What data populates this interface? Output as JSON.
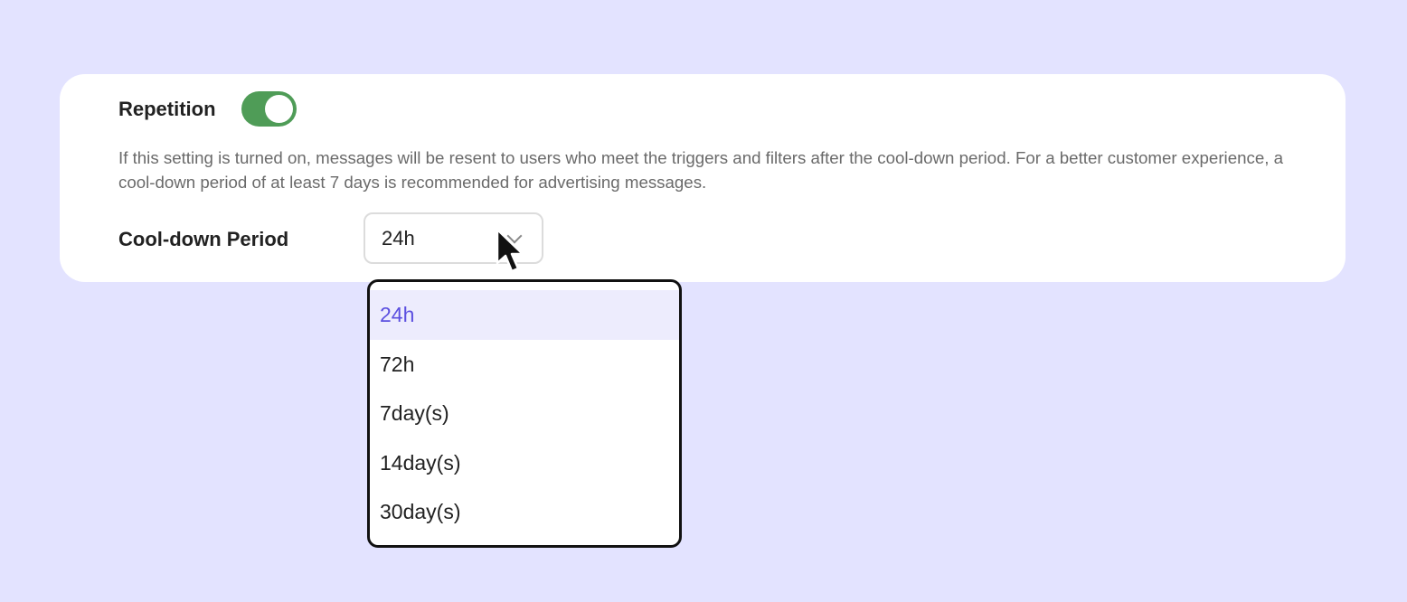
{
  "setting": {
    "title": "Repetition",
    "enabled": true,
    "description": "If this setting is turned on, messages will be resent to users who meet the triggers and filters after the cool-down period. For a better customer experience, a cool-down period of at least 7 days is recommended for advertising messages."
  },
  "cooldown": {
    "label": "Cool-down Period",
    "selected": "24h",
    "options": [
      {
        "label": "24h",
        "selected": true
      },
      {
        "label": "72h",
        "selected": false
      },
      {
        "label": "7day(s)",
        "selected": false
      },
      {
        "label": "14day(s)",
        "selected": false
      },
      {
        "label": "30day(s)",
        "selected": false
      }
    ]
  },
  "colors": {
    "background": "#e3e3ff",
    "toggle_on": "#4f9c57",
    "selected_option_text": "#5b4fe0",
    "selected_option_bg": "#edecfd"
  },
  "icons": {
    "select_chevron": "chevron-down-icon",
    "pointer": "mouse-cursor-icon"
  }
}
